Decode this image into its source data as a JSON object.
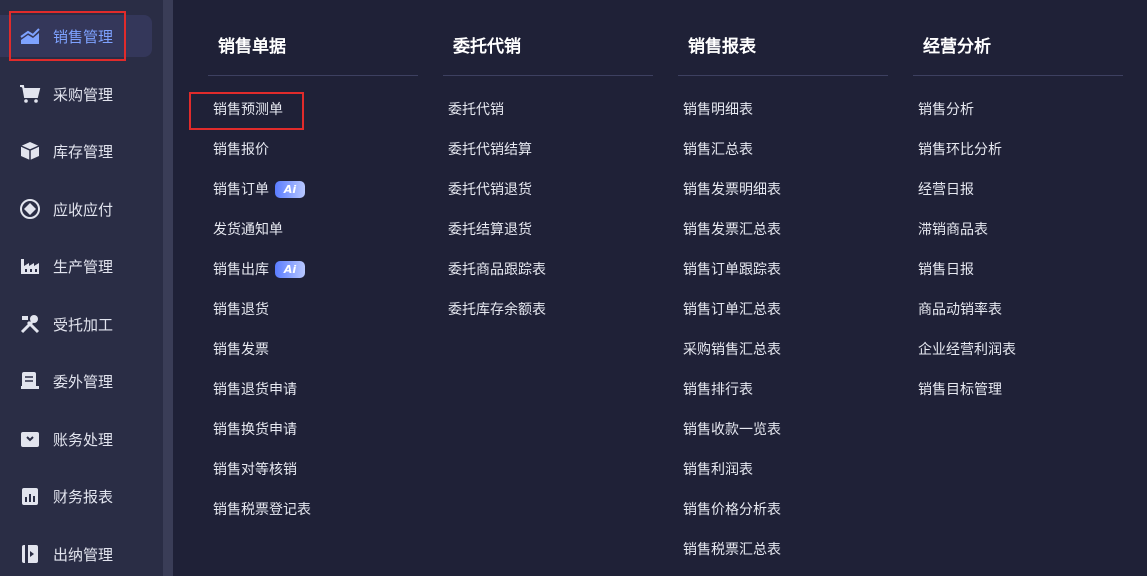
{
  "sidebar": {
    "items": [
      {
        "label": "销售管理",
        "icon": "sales-chart-icon",
        "active": true
      },
      {
        "label": "采购管理",
        "icon": "shopping-cart-icon"
      },
      {
        "label": "库存管理",
        "icon": "package-box-icon"
      },
      {
        "label": "应收应付",
        "icon": "diamond-icon"
      },
      {
        "label": "生产管理",
        "icon": "factory-icon"
      },
      {
        "label": "受托加工",
        "icon": "tools-icon"
      },
      {
        "label": "委外管理",
        "icon": "document-icon"
      },
      {
        "label": "账务处理",
        "icon": "ledger-icon"
      },
      {
        "label": "财务报表",
        "icon": "report-icon"
      },
      {
        "label": "出纳管理",
        "icon": "cashier-icon"
      }
    ]
  },
  "columns": [
    {
      "title": "销售单据",
      "items": [
        {
          "label": "销售预测单"
        },
        {
          "label": "销售报价"
        },
        {
          "label": "销售订单",
          "badge": "Ai"
        },
        {
          "label": "发货通知单"
        },
        {
          "label": "销售出库",
          "badge": "Ai"
        },
        {
          "label": "销售退货"
        },
        {
          "label": "销售发票"
        },
        {
          "label": "销售退货申请"
        },
        {
          "label": "销售换货申请"
        },
        {
          "label": "销售对等核销"
        },
        {
          "label": "销售税票登记表"
        }
      ]
    },
    {
      "title": "委托代销",
      "items": [
        {
          "label": "委托代销"
        },
        {
          "label": "委托代销结算"
        },
        {
          "label": "委托代销退货"
        },
        {
          "label": "委托结算退货"
        },
        {
          "label": "委托商品跟踪表"
        },
        {
          "label": "委托库存余额表"
        }
      ]
    },
    {
      "title": "销售报表",
      "items": [
        {
          "label": "销售明细表"
        },
        {
          "label": "销售汇总表"
        },
        {
          "label": "销售发票明细表"
        },
        {
          "label": "销售发票汇总表"
        },
        {
          "label": "销售订单跟踪表"
        },
        {
          "label": "销售订单汇总表"
        },
        {
          "label": "采购销售汇总表"
        },
        {
          "label": "销售排行表"
        },
        {
          "label": "销售收款一览表"
        },
        {
          "label": "销售利润表"
        },
        {
          "label": "销售价格分析表"
        },
        {
          "label": "销售税票汇总表"
        }
      ]
    },
    {
      "title": "经营分析",
      "items": [
        {
          "label": "销售分析"
        },
        {
          "label": "销售环比分析"
        },
        {
          "label": "经营日报"
        },
        {
          "label": "滞销商品表"
        },
        {
          "label": "销售日报"
        },
        {
          "label": "商品动销率表"
        },
        {
          "label": "企业经营利润表"
        },
        {
          "label": "销售目标管理"
        }
      ]
    }
  ],
  "colors": {
    "accent": "#7ea2ff",
    "highlight": "#e02b2b"
  }
}
